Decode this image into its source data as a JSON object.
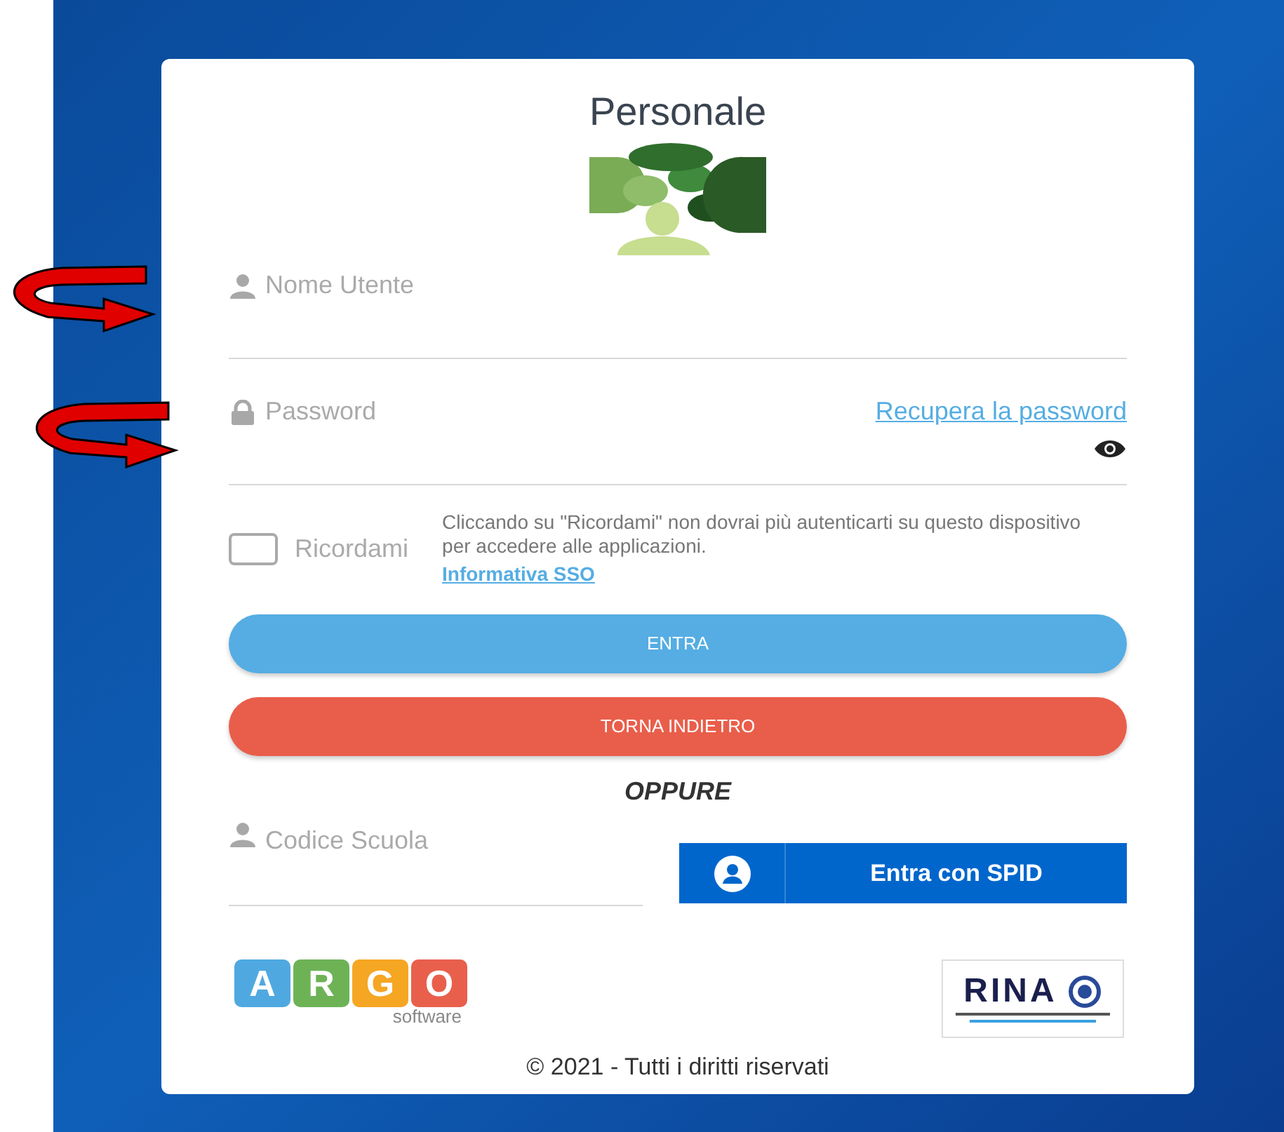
{
  "title": "Personale",
  "username": {
    "placeholder": "Nome Utente"
  },
  "password": {
    "placeholder": "Password",
    "recover_link": "Recupera la password"
  },
  "remember": {
    "label": "Ricordami",
    "checked": false,
    "note": "Cliccando su \"Ricordami\" non dovrai più autenticarti su questo dispositivo per accedere alle applicazioni.",
    "link": "Informativa SSO"
  },
  "buttons": [
    {
      "label": "ENTRA",
      "kind": "primary"
    },
    {
      "label": "TORNA INDIETRO",
      "kind": "danger"
    }
  ],
  "separator": "OPPURE",
  "school_code": {
    "placeholder": "Codice Scuola"
  },
  "spid_button": "Entra con SPID",
  "argo_logo": {
    "letters": [
      {
        "text": "A",
        "color": "#4fa9e0"
      },
      {
        "text": "R",
        "color": "#6db356"
      },
      {
        "text": "G",
        "color": "#f5a623"
      },
      {
        "text": "O",
        "color": "#e8604c"
      }
    ],
    "subtitle": "software"
  },
  "rina_logo": "RINA",
  "footer": "© 2021 - Tutti i diritti riservati"
}
